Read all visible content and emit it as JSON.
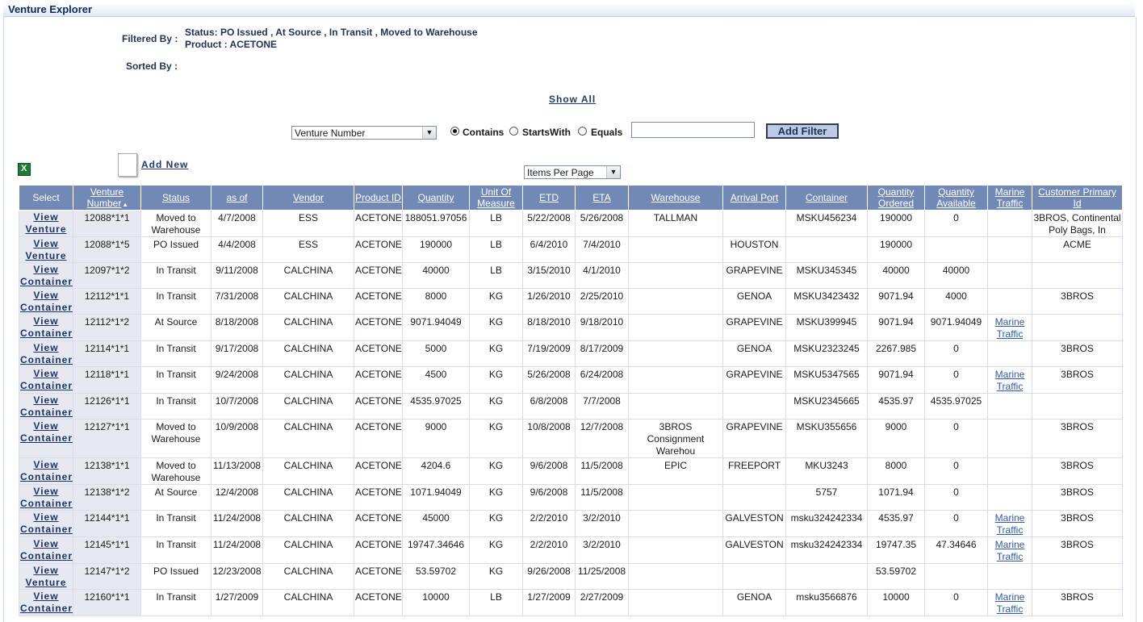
{
  "title": "Venture Explorer",
  "filtered_by_label": "Filtered By :",
  "filtered_status": "Status: PO Issued , At Source , In Transit , Moved to Warehouse",
  "filtered_product": "Product : ACETONE",
  "sorted_by_label": "Sorted By :",
  "show_all": "Show All",
  "filter": {
    "field": "Venture Number",
    "contains": "Contains",
    "starts_with": "StartsWith",
    "equals": "Equals",
    "value": "",
    "add_filter": "Add Filter"
  },
  "add_new": "Add New",
  "items_per_page": "Items Per Page",
  "columns": [
    "Select",
    "Venture Number",
    "Status",
    "as of",
    "Vendor",
    "Product ID",
    "Quantity",
    "Unit Of Measure",
    "ETD",
    "ETA",
    "Warehouse",
    "Arrival Port",
    "Container",
    "Quantity Ordered",
    "Quantity Available",
    "Marine Traffic",
    "Customer Primary Id"
  ],
  "rows": [
    {
      "sel": [
        "View",
        "Venture"
      ],
      "vn": "12088*1*1",
      "status": "Moved to Warehouse",
      "asof": "4/7/2008",
      "vendor": "ESS",
      "prod": "ACETONE",
      "qty": "188051.97056",
      "uom": "LB",
      "etd": "5/22/2008",
      "eta": "5/26/2008",
      "wh": "TALLMAN",
      "port": "",
      "cont": "MSKU456234",
      "qo": "190000",
      "qa": "0",
      "mt": "",
      "cust": "3BROS, Continental Poly Bags, In"
    },
    {
      "sel": [
        "View",
        "Venture"
      ],
      "vn": "12088*1*5",
      "status": "PO Issued",
      "asof": "4/4/2008",
      "vendor": "ESS",
      "prod": "ACETONE",
      "qty": "190000",
      "uom": "LB",
      "etd": "6/4/2010",
      "eta": "7/4/2010",
      "wh": "",
      "port": "HOUSTON",
      "cont": "",
      "qo": "190000",
      "qa": "",
      "mt": "",
      "cust": "ACME"
    },
    {
      "sel": [
        "View",
        "Container"
      ],
      "vn": "12097*1*2",
      "status": "In Transit",
      "asof": "9/11/2008",
      "vendor": "CALCHINA",
      "prod": "ACETONE",
      "qty": "40000",
      "uom": "LB",
      "etd": "3/15/2010",
      "eta": "4/1/2010",
      "wh": "",
      "port": "GRAPEVINE",
      "cont": "MSKU345345",
      "qo": "40000",
      "qa": "40000",
      "mt": "",
      "cust": ""
    },
    {
      "sel": [
        "View",
        "Container"
      ],
      "vn": "12112*1*1",
      "status": "In Transit",
      "asof": "7/31/2008",
      "vendor": "CALCHINA",
      "prod": "ACETONE",
      "qty": "8000",
      "uom": "KG",
      "etd": "1/26/2010",
      "eta": "2/25/2010",
      "wh": "",
      "port": "GENOA",
      "cont": "MSKU3423432",
      "qo": "9071.94",
      "qa": "4000",
      "mt": "",
      "cust": "3BROS"
    },
    {
      "sel": [
        "View",
        "Container"
      ],
      "vn": "12112*1*2",
      "status": "At Source",
      "asof": "8/18/2008",
      "vendor": "CALCHINA",
      "prod": "ACETONE",
      "qty": "9071.94049",
      "uom": "KG",
      "etd": "8/18/2010",
      "eta": "9/18/2010",
      "wh": "",
      "port": "GRAPEVINE",
      "cont": "MSKU399945",
      "qo": "9071.94",
      "qa": "9071.94049",
      "mt": "Marine Traffic",
      "cust": ""
    },
    {
      "sel": [
        "View",
        "Container"
      ],
      "vn": "12114*1*1",
      "status": "In Transit",
      "asof": "9/17/2008",
      "vendor": "CALCHINA",
      "prod": "ACETONE",
      "qty": "5000",
      "uom": "KG",
      "etd": "7/19/2009",
      "eta": "8/17/2009",
      "wh": "",
      "port": "GENOA",
      "cont": "MSKU2323245",
      "qo": "2267.985",
      "qa": "0",
      "mt": "",
      "cust": "3BROS"
    },
    {
      "sel": [
        "View",
        "Container"
      ],
      "vn": "12118*1*1",
      "status": "In Transit",
      "asof": "9/24/2008",
      "vendor": "CALCHINA",
      "prod": "ACETONE",
      "qty": "4500",
      "uom": "KG",
      "etd": "5/26/2008",
      "eta": "6/24/2008",
      "wh": "",
      "port": "GRAPEVINE",
      "cont": "MSKU5347565",
      "qo": "9071.94",
      "qa": "0",
      "mt": "Marine Traffic",
      "cust": "3BROS"
    },
    {
      "sel": [
        "View",
        "Container"
      ],
      "vn": "12126*1*1",
      "status": "In Transit",
      "asof": "10/7/2008",
      "vendor": "CALCHINA",
      "prod": "ACETONE",
      "qty": "4535.97025",
      "uom": "KG",
      "etd": "6/8/2008",
      "eta": "7/7/2008",
      "wh": "",
      "port": "",
      "cont": "MSKU2345665",
      "qo": "4535.97",
      "qa": "4535.97025",
      "mt": "",
      "cust": ""
    },
    {
      "sel": [
        "View",
        "Container"
      ],
      "vn": "12127*1*1",
      "status": "Moved to Warehouse",
      "asof": "10/9/2008",
      "vendor": "CALCHINA",
      "prod": "ACETONE",
      "qty": "9000",
      "uom": "KG",
      "etd": "10/8/2008",
      "eta": "12/7/2008",
      "wh": "3BROS Consignment Warehou",
      "port": "GRAPEVINE",
      "cont": "MSKU355656",
      "qo": "9000",
      "qa": "0",
      "mt": "",
      "cust": "3BROS"
    },
    {
      "sel": [
        "View",
        "Container"
      ],
      "vn": "12138*1*1",
      "status": "Moved to Warehouse",
      "asof": "11/13/2008",
      "vendor": "CALCHINA",
      "prod": "ACETONE",
      "qty": "4204.6",
      "uom": "KG",
      "etd": "9/6/2008",
      "eta": "11/5/2008",
      "wh": "EPIC",
      "port": "FREEPORT",
      "cont": "MKU3243",
      "qo": "8000",
      "qa": "0",
      "mt": "",
      "cust": "3BROS"
    },
    {
      "sel": [
        "View",
        "Container"
      ],
      "vn": "12138*1*2",
      "status": "At Source",
      "asof": "12/4/2008",
      "vendor": "CALCHINA",
      "prod": "ACETONE",
      "qty": "1071.94049",
      "uom": "KG",
      "etd": "9/6/2008",
      "eta": "11/5/2008",
      "wh": "",
      "port": "",
      "cont": "5757",
      "qo": "1071.94",
      "qa": "0",
      "mt": "",
      "cust": "3BROS"
    },
    {
      "sel": [
        "View",
        "Container"
      ],
      "vn": "12144*1*1",
      "status": "In Transit",
      "asof": "11/24/2008",
      "vendor": "CALCHINA",
      "prod": "ACETONE",
      "qty": "45000",
      "uom": "KG",
      "etd": "2/2/2010",
      "eta": "3/2/2010",
      "wh": "",
      "port": "GALVESTON",
      "cont": "msku324242334",
      "qo": "4535.97",
      "qa": "0",
      "mt": "Marine Traffic",
      "cust": "3BROS"
    },
    {
      "sel": [
        "View",
        "Container"
      ],
      "vn": "12145*1*1",
      "status": "In Transit",
      "asof": "11/24/2008",
      "vendor": "CALCHINA",
      "prod": "ACETONE",
      "qty": "19747.34646",
      "uom": "KG",
      "etd": "2/2/2010",
      "eta": "3/2/2010",
      "wh": "",
      "port": "GALVESTON",
      "cont": "msku324242334",
      "qo": "19747.35",
      "qa": "47.34646",
      "mt": "Marine Traffic",
      "cust": "3BROS"
    },
    {
      "sel": [
        "View",
        "Venture"
      ],
      "vn": "12147*1*2",
      "status": "PO Issued",
      "asof": "12/23/2008",
      "vendor": "CALCHINA",
      "prod": "ACETONE",
      "qty": "53.59702",
      "uom": "KG",
      "etd": "9/26/2008",
      "eta": "11/25/2008",
      "wh": "",
      "port": "",
      "cont": "",
      "qo": "53.59702",
      "qa": "",
      "mt": "",
      "cust": ""
    },
    {
      "sel": [
        "View",
        "Container"
      ],
      "vn": "12160*1*1",
      "status": "In Transit",
      "asof": "1/27/2009",
      "vendor": "CALCHINA",
      "prod": "ACETONE",
      "qty": "10000",
      "uom": "LB",
      "etd": "1/27/2009",
      "eta": "2/27/2009",
      "wh": "",
      "port": "GENOA",
      "cont": "msku3566876",
      "qo": "10000",
      "qa": "0",
      "mt": "Marine Traffic",
      "cust": "3BROS"
    }
  ]
}
